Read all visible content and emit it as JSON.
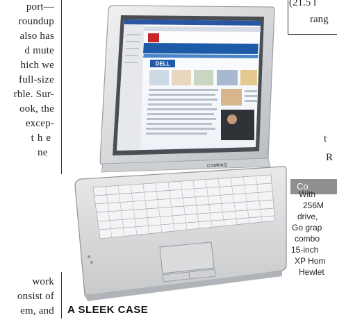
{
  "body_left": [
    "port—",
    "roundup",
    "also has",
    "d mute",
    "hich we",
    "full-size",
    "rble. Sur-",
    "ook, the",
    "excep-",
    "the",
    "ne",
    "work",
    "onsist of",
    "em, and"
  ],
  "body_right": [
    "(21.5 l",
    "rang",
    "t",
    "R"
  ],
  "specs": {
    "header": "Co",
    "lines": [
      "With",
      "256M",
      "drive,",
      "Go grap",
      "combo",
      "15-inch",
      "XP Hom",
      "Hewlet"
    ]
  },
  "photo": {
    "brand": "COMPAQ",
    "screen_logo": "DELL"
  },
  "caption": "A SLEEK CASE"
}
